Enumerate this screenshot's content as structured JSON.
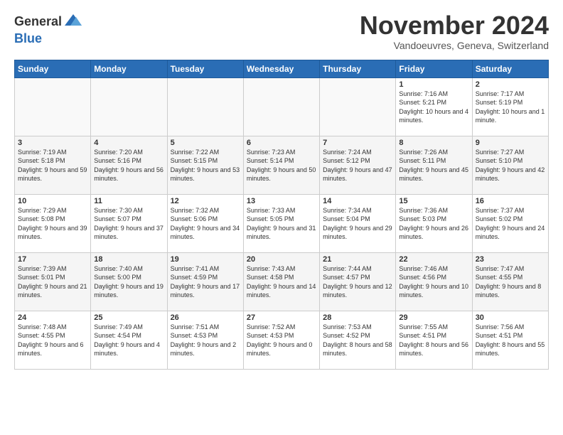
{
  "header": {
    "logo_general": "General",
    "logo_blue": "Blue",
    "month_title": "November 2024",
    "location": "Vandoeuvres, Geneva, Switzerland"
  },
  "weekdays": [
    "Sunday",
    "Monday",
    "Tuesday",
    "Wednesday",
    "Thursday",
    "Friday",
    "Saturday"
  ],
  "weeks": [
    [
      {
        "day": "",
        "info": ""
      },
      {
        "day": "",
        "info": ""
      },
      {
        "day": "",
        "info": ""
      },
      {
        "day": "",
        "info": ""
      },
      {
        "day": "",
        "info": ""
      },
      {
        "day": "1",
        "info": "Sunrise: 7:16 AM\nSunset: 5:21 PM\nDaylight: 10 hours and 4 minutes."
      },
      {
        "day": "2",
        "info": "Sunrise: 7:17 AM\nSunset: 5:19 PM\nDaylight: 10 hours and 1 minute."
      }
    ],
    [
      {
        "day": "3",
        "info": "Sunrise: 7:19 AM\nSunset: 5:18 PM\nDaylight: 9 hours and 59 minutes."
      },
      {
        "day": "4",
        "info": "Sunrise: 7:20 AM\nSunset: 5:16 PM\nDaylight: 9 hours and 56 minutes."
      },
      {
        "day": "5",
        "info": "Sunrise: 7:22 AM\nSunset: 5:15 PM\nDaylight: 9 hours and 53 minutes."
      },
      {
        "day": "6",
        "info": "Sunrise: 7:23 AM\nSunset: 5:14 PM\nDaylight: 9 hours and 50 minutes."
      },
      {
        "day": "7",
        "info": "Sunrise: 7:24 AM\nSunset: 5:12 PM\nDaylight: 9 hours and 47 minutes."
      },
      {
        "day": "8",
        "info": "Sunrise: 7:26 AM\nSunset: 5:11 PM\nDaylight: 9 hours and 45 minutes."
      },
      {
        "day": "9",
        "info": "Sunrise: 7:27 AM\nSunset: 5:10 PM\nDaylight: 9 hours and 42 minutes."
      }
    ],
    [
      {
        "day": "10",
        "info": "Sunrise: 7:29 AM\nSunset: 5:08 PM\nDaylight: 9 hours and 39 minutes."
      },
      {
        "day": "11",
        "info": "Sunrise: 7:30 AM\nSunset: 5:07 PM\nDaylight: 9 hours and 37 minutes."
      },
      {
        "day": "12",
        "info": "Sunrise: 7:32 AM\nSunset: 5:06 PM\nDaylight: 9 hours and 34 minutes."
      },
      {
        "day": "13",
        "info": "Sunrise: 7:33 AM\nSunset: 5:05 PM\nDaylight: 9 hours and 31 minutes."
      },
      {
        "day": "14",
        "info": "Sunrise: 7:34 AM\nSunset: 5:04 PM\nDaylight: 9 hours and 29 minutes."
      },
      {
        "day": "15",
        "info": "Sunrise: 7:36 AM\nSunset: 5:03 PM\nDaylight: 9 hours and 26 minutes."
      },
      {
        "day": "16",
        "info": "Sunrise: 7:37 AM\nSunset: 5:02 PM\nDaylight: 9 hours and 24 minutes."
      }
    ],
    [
      {
        "day": "17",
        "info": "Sunrise: 7:39 AM\nSunset: 5:01 PM\nDaylight: 9 hours and 21 minutes."
      },
      {
        "day": "18",
        "info": "Sunrise: 7:40 AM\nSunset: 5:00 PM\nDaylight: 9 hours and 19 minutes."
      },
      {
        "day": "19",
        "info": "Sunrise: 7:41 AM\nSunset: 4:59 PM\nDaylight: 9 hours and 17 minutes."
      },
      {
        "day": "20",
        "info": "Sunrise: 7:43 AM\nSunset: 4:58 PM\nDaylight: 9 hours and 14 minutes."
      },
      {
        "day": "21",
        "info": "Sunrise: 7:44 AM\nSunset: 4:57 PM\nDaylight: 9 hours and 12 minutes."
      },
      {
        "day": "22",
        "info": "Sunrise: 7:46 AM\nSunset: 4:56 PM\nDaylight: 9 hours and 10 minutes."
      },
      {
        "day": "23",
        "info": "Sunrise: 7:47 AM\nSunset: 4:55 PM\nDaylight: 9 hours and 8 minutes."
      }
    ],
    [
      {
        "day": "24",
        "info": "Sunrise: 7:48 AM\nSunset: 4:55 PM\nDaylight: 9 hours and 6 minutes."
      },
      {
        "day": "25",
        "info": "Sunrise: 7:49 AM\nSunset: 4:54 PM\nDaylight: 9 hours and 4 minutes."
      },
      {
        "day": "26",
        "info": "Sunrise: 7:51 AM\nSunset: 4:53 PM\nDaylight: 9 hours and 2 minutes."
      },
      {
        "day": "27",
        "info": "Sunrise: 7:52 AM\nSunset: 4:53 PM\nDaylight: 9 hours and 0 minutes."
      },
      {
        "day": "28",
        "info": "Sunrise: 7:53 AM\nSunset: 4:52 PM\nDaylight: 8 hours and 58 minutes."
      },
      {
        "day": "29",
        "info": "Sunrise: 7:55 AM\nSunset: 4:51 PM\nDaylight: 8 hours and 56 minutes."
      },
      {
        "day": "30",
        "info": "Sunrise: 7:56 AM\nSunset: 4:51 PM\nDaylight: 8 hours and 55 minutes."
      }
    ]
  ]
}
